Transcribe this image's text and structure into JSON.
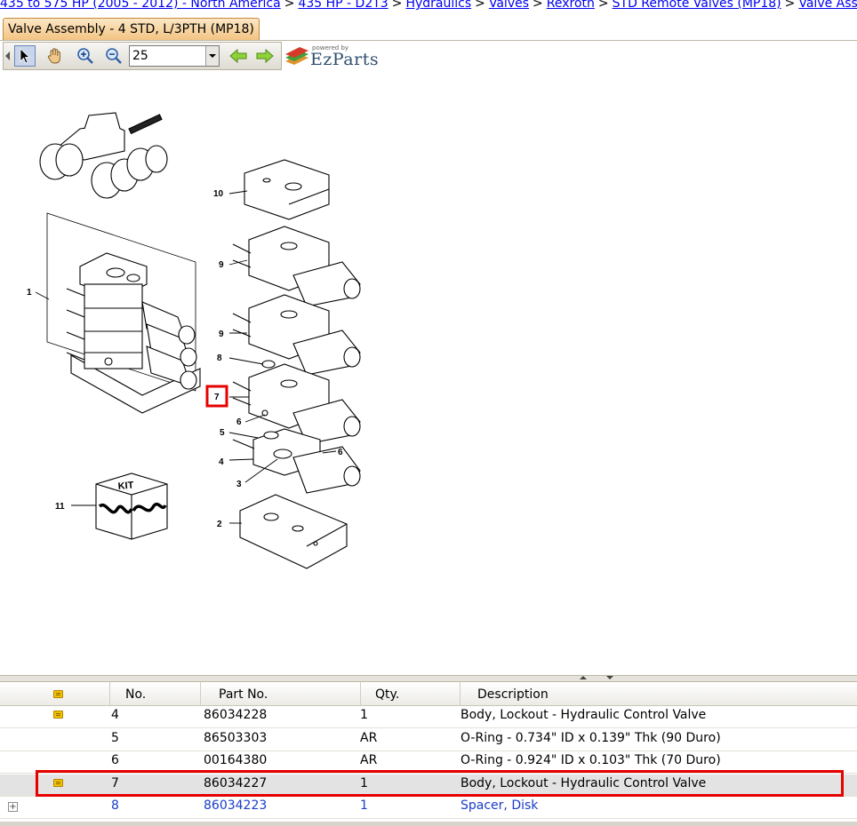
{
  "breadcrumb": [
    {
      "label": "435 to 575 HP (2005 - 2012) - North America",
      "link": true
    },
    {
      "label": "435 HP - D2T3",
      "link": true
    },
    {
      "label": "Hydraulics",
      "link": true
    },
    {
      "label": "Valves",
      "link": true
    },
    {
      "label": "Rexroth",
      "link": true
    },
    {
      "label": "STD Remote Valves (MP18)",
      "link": true
    },
    {
      "label": "Valve Ass",
      "link": true
    }
  ],
  "tab": {
    "label": "Valve Assembly - 4 STD, L/3PTH (MP18)"
  },
  "toolbar": {
    "zoom_value": "25",
    "logo_powered_by": "powered by",
    "logo_name": "EzParts",
    "icons": [
      "pointer-icon",
      "pan-hand-icon",
      "zoom-in-icon",
      "zoom-out-icon",
      "back-arrow-icon",
      "forward-arrow-icon",
      "ezparts-logo-icon"
    ]
  },
  "diagram": {
    "callouts": [
      "1",
      "2",
      "3",
      "4",
      "5",
      "6",
      "6",
      "7",
      "8",
      "9",
      "9",
      "10",
      "11"
    ],
    "kit_label": "KIT",
    "highlighted_callout": "7"
  },
  "table": {
    "headers": {
      "no": "No.",
      "part_no": "Part No.",
      "qty": "Qty.",
      "description": "Description"
    },
    "rows": [
      {
        "no": "4",
        "part_no": "86034228",
        "qty": "1",
        "description": "Body, Lockout - Hydraulic Control Valve",
        "note": true,
        "expand": false,
        "selected": false,
        "link": false
      },
      {
        "no": "5",
        "part_no": "86503303",
        "qty": "AR",
        "description": "O-Ring - 0.734\" ID x 0.139\" Thk (90 Duro)",
        "note": false,
        "expand": false,
        "selected": false,
        "link": false
      },
      {
        "no": "6",
        "part_no": "00164380",
        "qty": "AR",
        "description": "O-Ring - 0.924\" ID x 0.103\" Thk (70 Duro)",
        "note": false,
        "expand": false,
        "selected": false,
        "link": false
      },
      {
        "no": "7",
        "part_no": "86034227",
        "qty": "1",
        "description": "Body, Lockout - Hydraulic Control Valve",
        "note": true,
        "expand": false,
        "selected": true,
        "link": false
      },
      {
        "no": "8",
        "part_no": "86034223",
        "qty": "1",
        "description": "Spacer, Disk",
        "note": false,
        "expand": true,
        "selected": false,
        "link": true
      }
    ]
  },
  "colors": {
    "highlight": "#e60000",
    "tab_bg": "#f3c483",
    "link": "#0000ee",
    "selected_row": "#e3e3e3"
  }
}
